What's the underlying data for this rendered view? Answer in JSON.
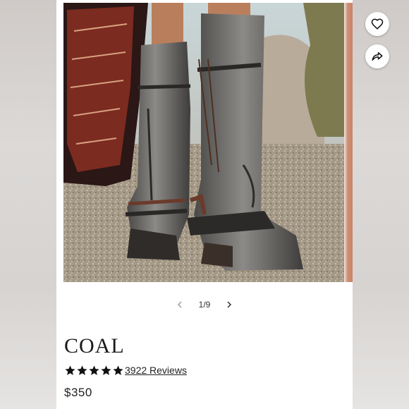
{
  "product": {
    "name": "COAL",
    "price": "$350",
    "rating": 5,
    "reviews_label": "3922 Reviews"
  },
  "gallery": {
    "counter": "1/9",
    "image_alt": "Distressed grey lace-up knee-high boots"
  },
  "icons": {
    "favorite": "heart-icon",
    "share": "share-icon",
    "prev": "chevron-left-icon",
    "next": "chevron-right-icon",
    "star": "star-icon"
  },
  "colors": {
    "text": "#1a1a1a",
    "star": "#111111",
    "card": "#ffffff"
  }
}
